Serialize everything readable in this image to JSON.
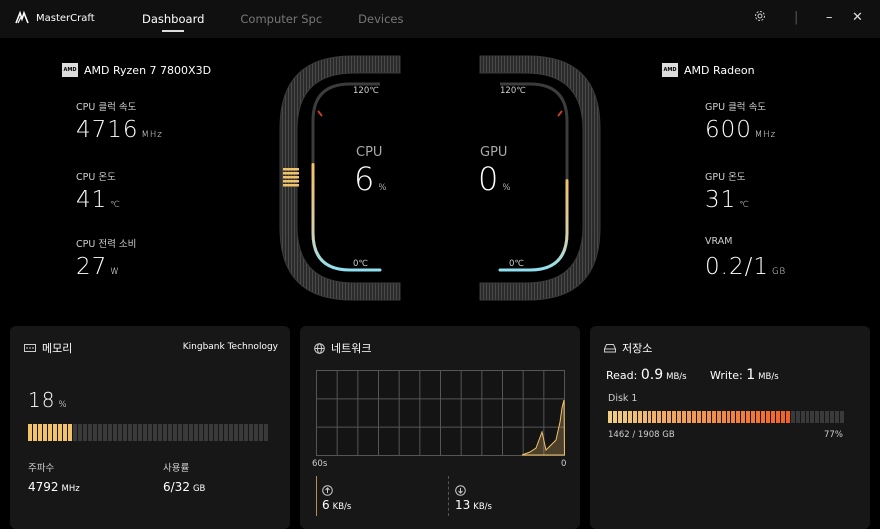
{
  "app": {
    "title": "MasterCraft"
  },
  "tabs": [
    {
      "label": "Dashboard"
    },
    {
      "label": "Computer Spc"
    },
    {
      "label": "Devices"
    }
  ],
  "cpu": {
    "name": "AMD Ryzen 7 7800X3D",
    "chip_logo": "AMD",
    "clock_label": "CPU 클럭 속도",
    "clock_value": "4716",
    "clock_unit": "MHz",
    "temp_label": "CPU 온도",
    "temp_value": "41",
    "temp_unit": "℃",
    "power_label": "CPU 전력 소비",
    "power_value": "27",
    "power_unit": "W",
    "gauge_label": "CPU",
    "usage_value": "6",
    "usage_unit": "%",
    "gauge_max": "120℃",
    "gauge_min": "0℃",
    "temp_fraction": 0.34
  },
  "gpu": {
    "name": "AMD Radeon",
    "chip_logo": "AMD",
    "clock_label": "GPU 클럭 속도",
    "clock_value": "600",
    "clock_unit": "MHz",
    "temp_label": "GPU 온도",
    "temp_value": "31",
    "temp_unit": "℃",
    "vram_label": "VRAM",
    "vram_value": "0.2/1",
    "vram_unit": "GB",
    "gauge_label": "GPU",
    "usage_value": "0",
    "usage_unit": "%",
    "gauge_max": "120℃",
    "gauge_min": "0℃",
    "temp_fraction": 0.26
  },
  "memory": {
    "title": "메모리",
    "brand": "Kingbank Technology",
    "usage_value": "18",
    "usage_unit": "%",
    "usage_fraction": 0.18,
    "freq_label": "주파수",
    "freq_value": "4792",
    "freq_unit": "MHz",
    "used_label": "사용률",
    "used_value": "6/32",
    "used_unit": "GB"
  },
  "network": {
    "title": "네트워크",
    "x_left": "60s",
    "x_right": "0",
    "upload_value": "6",
    "upload_unit": "KB/s",
    "download_value": "13",
    "download_unit": "KB/s"
  },
  "storage": {
    "title": "저장소",
    "read_label": "Read:",
    "read_value": "0.9",
    "read_unit": "MB/s",
    "write_label": "Write:",
    "write_value": "1",
    "write_unit": "MB/s",
    "disk_name": "Disk 1",
    "disk_usage": "1462 / 1908 GB",
    "disk_percent": "77%",
    "disk_fraction": 0.77
  },
  "colors": {
    "accent": "#f2c26b",
    "gauge_cool": "#8fe0f0",
    "storage_bar": "#e8742a"
  }
}
